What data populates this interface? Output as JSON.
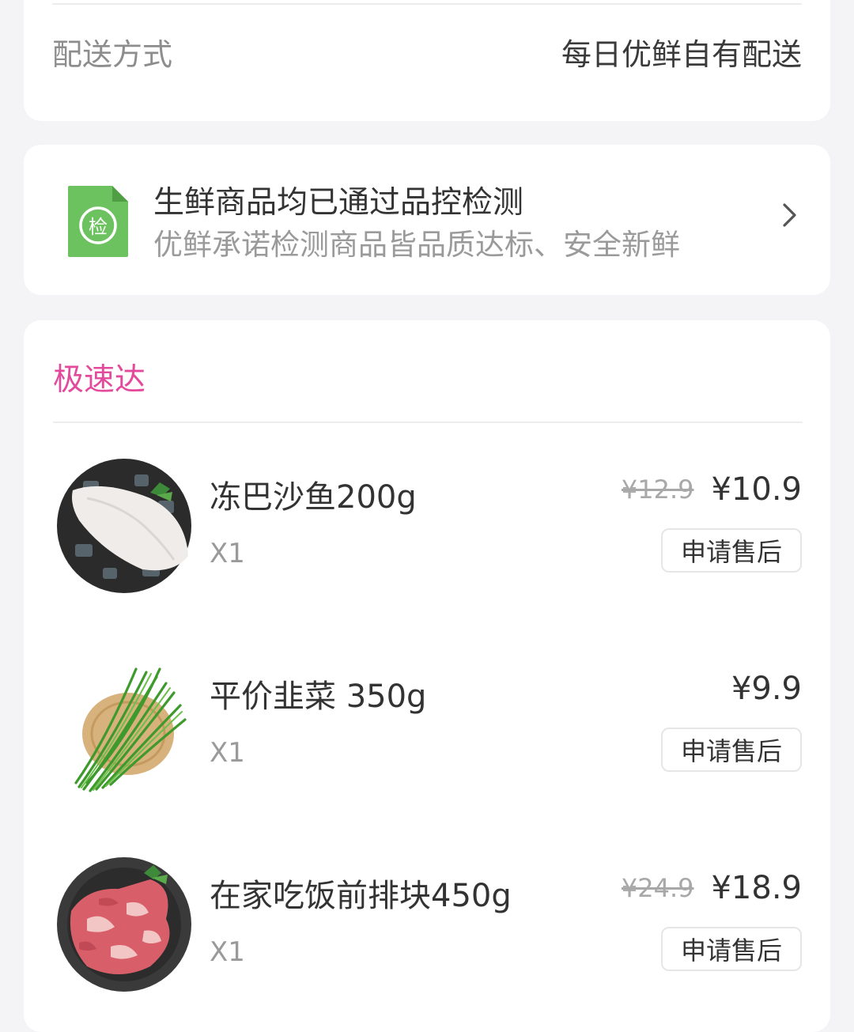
{
  "delivery": {
    "label": "配送方式",
    "value": "每日优鲜自有配送"
  },
  "quality_banner": {
    "icon": "inspection-doc-icon",
    "icon_text": "检",
    "title": "生鲜商品均已通过品控检测",
    "subtitle": "优鲜承诺检测商品皆品质达标、安全新鲜"
  },
  "order_section": {
    "title": "极速达",
    "accent_color": "#e34a9c",
    "items": [
      {
        "name": "冻巴沙鱼200g",
        "quantity": "X1",
        "original_price": "¥12.9",
        "price": "¥10.9",
        "action_label": "申请售后",
        "image": "basa-fish-fillet-image"
      },
      {
        "name": "平价韭菜 350g",
        "quantity": "X1",
        "original_price": "",
        "price": "¥9.9",
        "action_label": "申请售后",
        "image": "chives-image"
      },
      {
        "name": "在家吃饭前排块450g",
        "quantity": "X1",
        "original_price": "¥24.9",
        "price": "¥18.9",
        "action_label": "申请售后",
        "image": "pork-ribs-image"
      }
    ]
  }
}
